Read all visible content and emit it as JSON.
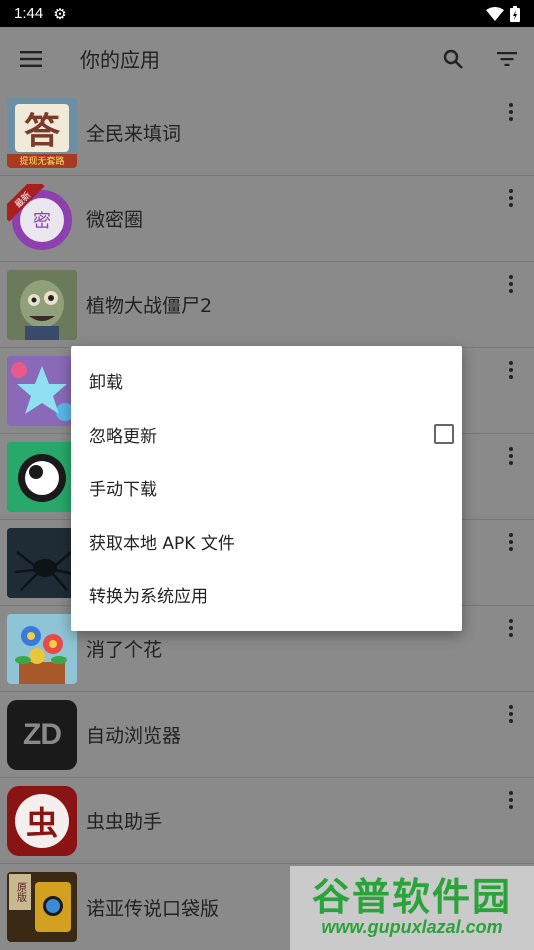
{
  "status_bar": {
    "time": "1:44"
  },
  "app_bar": {
    "title": "你的应用"
  },
  "apps": [
    {
      "name": "全民来填词",
      "icon_name": "tianci-app-icon",
      "icon_glyph": "答",
      "icon_caption": "提现无套路"
    },
    {
      "name": "微密圈",
      "icon_name": "weimiquan-app-icon",
      "icon_glyph": "密",
      "icon_badge": "最新"
    },
    {
      "name": "植物大战僵尸2",
      "icon_name": "pvz2-app-icon"
    },
    {
      "name": "",
      "icon_name": "star-game-app-icon"
    },
    {
      "name": "",
      "icon_name": "green-bubble-app-icon"
    },
    {
      "name": "",
      "icon_name": "dark-spider-app-icon"
    },
    {
      "name": "消了个花",
      "icon_name": "xiaolegehua-app-icon"
    },
    {
      "name": "自动浏览器",
      "icon_name": "zd-browser-app-icon",
      "icon_glyph": "ZD"
    },
    {
      "name": "虫虫助手",
      "icon_name": "chongchong-app-icon",
      "icon_glyph": "虫"
    },
    {
      "name": "诺亚传说口袋版",
      "icon_name": "noah-legend-app-icon",
      "icon_glyph": "原版"
    }
  ],
  "popup_menu": {
    "items": [
      {
        "label": "卸载"
      },
      {
        "label": "忽略更新",
        "checkbox": false
      },
      {
        "label": "手动下载"
      },
      {
        "label": "获取本地 APK 文件"
      },
      {
        "label": "转换为系统应用"
      }
    ]
  },
  "watermark": {
    "text_cn": "谷普软件园",
    "url": "www.gupuxlazal.com"
  }
}
